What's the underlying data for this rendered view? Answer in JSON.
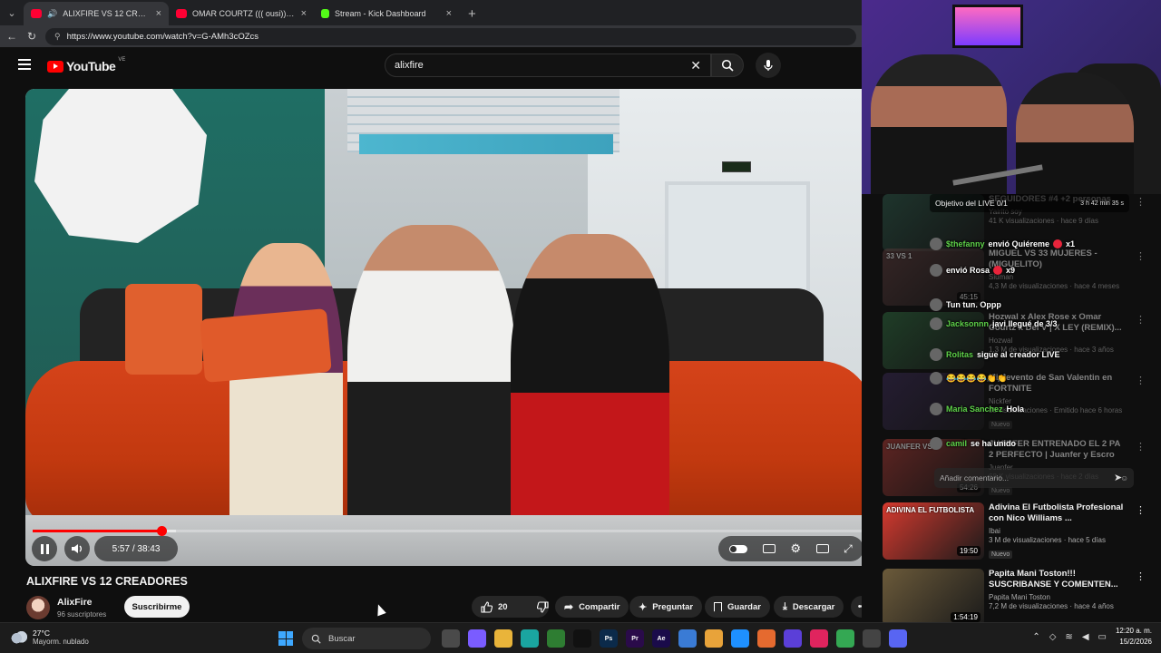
{
  "browser": {
    "tabs": [
      {
        "title": "ALIXFIRE VS 12 CREADORES",
        "favicon_color": "#ff0033",
        "active": true
      },
      {
        "title": "OMAR COURTZ ((( ousi))) x KARBe",
        "favicon_color": "#ff0033",
        "active": false
      },
      {
        "title": "Stream - Kick Dashboard",
        "favicon_color": "#53fc18",
        "active": false
      }
    ],
    "url": "https://www.youtube.com/watch?v=G-AMh3cOZcs"
  },
  "youtube": {
    "logo_text": "YouTube",
    "country_code": "VE",
    "search_query": "alixfire"
  },
  "player": {
    "current_time": "5:57",
    "duration": "38:43",
    "time_display": "5:57 / 38:43",
    "progress_fraction": 0.154,
    "buffered_fraction": 0.172,
    "accent": "#ff0000"
  },
  "video": {
    "title": "ALIXFIRE VS 12 CREADORES",
    "channel": "AlixFire",
    "subscribers": "96 suscriptores",
    "subscribe_label": "Suscribirme",
    "likes": "20",
    "share_label": "Compartir",
    "ask_label": "Preguntar",
    "save_label": "Guardar",
    "download_label": "Descargar"
  },
  "recommendations": [
    {
      "title": "SEGUIDORES #4 +2 personas",
      "channel": "Yairito soy",
      "meta": "41 K visualizaciones · hace 9 días",
      "duration": "",
      "thumb": "#2d5a4a",
      "faded": true
    },
    {
      "title": "MIGUEL VS 33 MUJERES - (MIGUELITO)",
      "channel": "Siuman",
      "meta": "4,3 M de visualizaciones · hace 4 meses",
      "duration": "45:15",
      "thumb": "#5a3b3b",
      "thumb_label": "33 VS 1",
      "faded": true
    },
    {
      "title": "Hozwal x Alex Rose x Omar Courtz x Dei V | X LEY (REMIX)...",
      "channel": "Hozwal",
      "meta": "1,3 M de visualizaciones · hace 3 años",
      "duration": "",
      "thumb": "#2f6b3f",
      "faded": true
    },
    {
      "title": "Minievento de San Valentin en FORTNITE",
      "channel": "Nickfer",
      "meta": "85 visualizaciones · Emitido hace 6 horas",
      "duration": "",
      "badge": "Nuevo",
      "thumb": "#3a2a55",
      "faded": true
    },
    {
      "title": "JUANFER ENTRENADO EL 2 PA 2 PERFECTO | Juanfer y Escro",
      "channel": "Juanfer",
      "meta": "68 K visualizaciones · hace 2 días",
      "duration": "54:26",
      "badge": "Nuevo",
      "thumb": "#aa3a35",
      "thumb_label": "JUANFER VS 2",
      "faded": true
    },
    {
      "title": "Adivina El Futbolista Profesional con Nico Williams ...",
      "channel": "Ibai",
      "meta": "3 M de visualizaciones · hace 5 días",
      "duration": "19:50",
      "badge": "Nuevo",
      "thumb": "#d63a2f",
      "thumb_label": "ADIVINA EL FUTBOLISTA",
      "faded": false
    },
    {
      "title": "Papita Mani Toston!!! SUSCRIBANSE Y COMENTEN...",
      "channel": "Papita Mani Toston",
      "meta": "7,2 M de visualizaciones · hace 4 años",
      "duration": "1:54:19",
      "thumb": "#6b5a3a",
      "faded": false
    }
  ],
  "kick_chat": {
    "objective_label": "Objetivo del LIVE 0/1",
    "objective_timer": "3 h 42 min 35 s",
    "messages": [
      {
        "user": "$thefanny",
        "text": "envió Quiéreme",
        "count": "x1"
      },
      {
        "user": "",
        "text": "envió Rosa",
        "count": "x9"
      },
      {
        "user": "",
        "text": "Tun tun. Oppp",
        "count": ""
      },
      {
        "user": "Jacksonnn",
        "text": "javi llegué de 3/3",
        "count": ""
      },
      {
        "user": "Rolitas",
        "text": "sigue al creador LIVE",
        "count": ""
      },
      {
        "user": "",
        "text": "😂😂😂😂👏👏",
        "count": ""
      },
      {
        "user": "Maria Sanchez",
        "text": "Hola",
        "count": ""
      },
      {
        "user": "camil",
        "text": "se ha unido",
        "count": ""
      }
    ],
    "comment_placeholder": "Añadir comentario..."
  },
  "taskbar": {
    "temperature": "27°C",
    "weather": "Mayorm. nublado",
    "search_label": "Buscar",
    "apps": [
      {
        "label": "",
        "color": "#4a4a4a"
      },
      {
        "label": "",
        "color": "#7a5cff"
      },
      {
        "label": "",
        "color": "#e9b43a"
      },
      {
        "label": "",
        "color": "#1aa5a0"
      },
      {
        "label": "",
        "color": "#2e7d32"
      },
      {
        "label": "",
        "color": "#111111"
      },
      {
        "label": "Ps",
        "color": "#0b2a4a"
      },
      {
        "label": "Pr",
        "color": "#2a0b4a"
      },
      {
        "label": "Ae",
        "color": "#1a0b4a"
      },
      {
        "label": "",
        "color": "#3a7bd5"
      },
      {
        "label": "",
        "color": "#e8a33a"
      },
      {
        "label": "",
        "color": "#1e90ff"
      },
      {
        "label": "",
        "color": "#e56a2f"
      },
      {
        "label": "",
        "color": "#5b3fd8"
      },
      {
        "label": "",
        "color": "#e0245e"
      },
      {
        "label": "",
        "color": "#34a853"
      },
      {
        "label": "",
        "color": "#444444"
      },
      {
        "label": "",
        "color": "#5865f2"
      }
    ],
    "time": "12:20 a. m.",
    "date": "15/2/2026"
  }
}
